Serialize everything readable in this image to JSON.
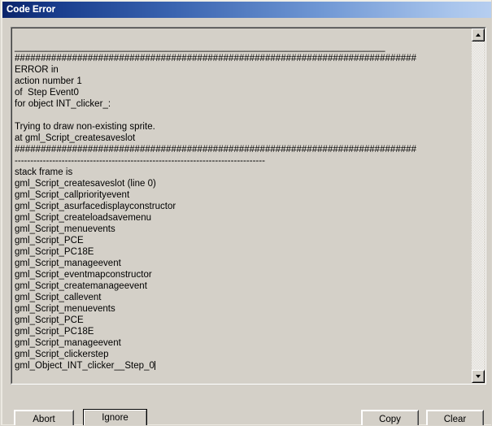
{
  "window": {
    "title": "Code Error",
    "titlebar_gradient_start": "#0a246a",
    "titlebar_gradient_end": "#b6cef0",
    "face_color": "#d4d0c8"
  },
  "error_text": {
    "lines": [
      "",
      "_______________________________________________________________________",
      "#############################################################################",
      "ERROR in",
      "action number 1",
      "of  Step Event0",
      "for object INT_clicker_:",
      "",
      "Trying to draw non-existing sprite.",
      "at gml_Script_createsaveslot",
      "#############################################################################",
      "--------------------------------------------------------------------------------",
      "stack frame is",
      "gml_Script_createsaveslot (line 0)",
      "gml_Script_callpriorityevent",
      "gml_Script_asurfacedisplayconstructor",
      "gml_Script_createloadsavemenu",
      "gml_Script_menuevents",
      "gml_Script_PCE",
      "gml_Script_PC18E",
      "gml_Script_manageevent",
      "gml_Script_eventmapconstructor",
      "gml_Script_createmanageevent",
      "gml_Script_callevent",
      "gml_Script_menuevents",
      "gml_Script_PCE",
      "gml_Script_PC18E",
      "gml_Script_manageevent",
      "gml_Script_clickerstep",
      "gml_Object_INT_clicker__Step_0"
    ],
    "caret_after_last_line": true
  },
  "scrollbar": {
    "up_arrow_icon": "scroll-up-arrow-icon",
    "down_arrow_icon": "scroll-down-arrow-icon",
    "thumb_visible": false
  },
  "buttons": {
    "abort": "Abort",
    "ignore": "Ignore",
    "copy": "Copy",
    "clear": "Clear",
    "focused": "ignore"
  }
}
